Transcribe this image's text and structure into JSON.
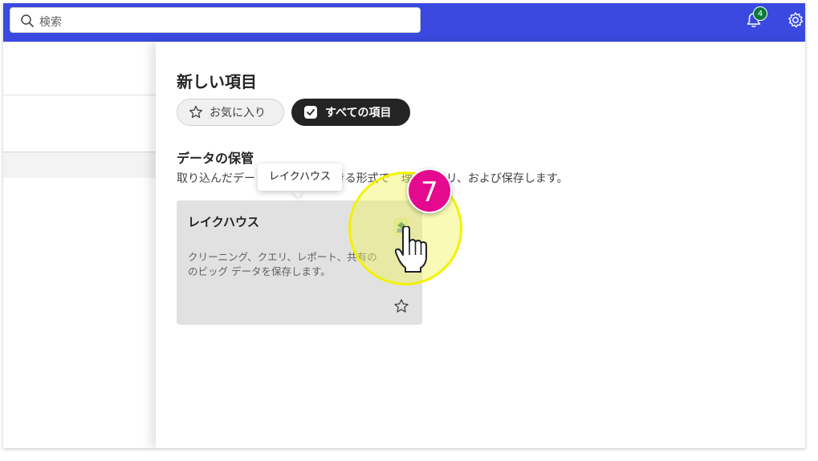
{
  "topbar": {
    "search_placeholder": "検索",
    "notification_count": "4",
    "accent_color": "#3a49e0"
  },
  "panel": {
    "title": "新しい項目",
    "filters": [
      {
        "label": "お気に入り",
        "icon": "star-icon",
        "selected": false
      },
      {
        "label": "すべての項目",
        "icon": "checkbox-icon",
        "selected": true
      }
    ],
    "section": {
      "title": "データの保管",
      "description": "取り込んだデー　　　　　得できる形式で　理、クエリ、および保存します。"
    },
    "card": {
      "title": "レイクハウス",
      "description": "クリーニング、クエリ、レポート、共有の　　のビッグ データを保存します。",
      "icon": "lakehouse-icon",
      "favorite_icon": "star-icon"
    },
    "tooltip": "レイクハウス"
  },
  "annotation": {
    "step_number": "7",
    "step_color": "#e4098e",
    "highlight_color": "#f2f200"
  }
}
